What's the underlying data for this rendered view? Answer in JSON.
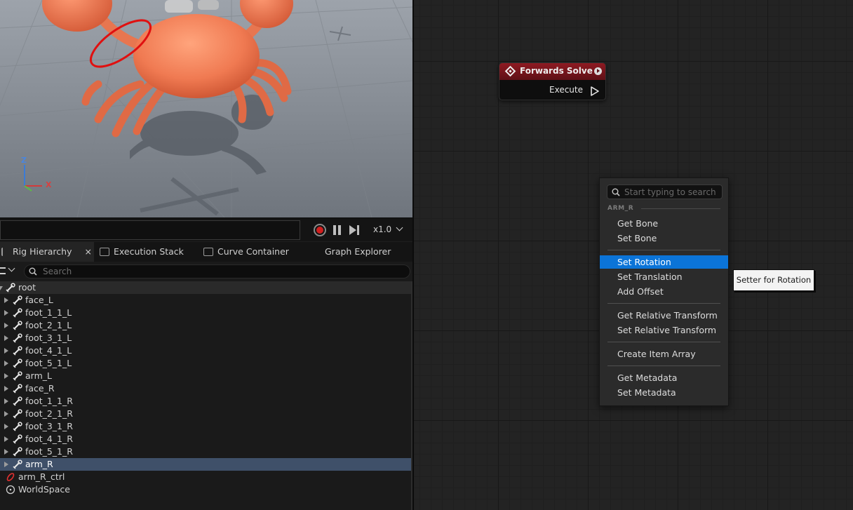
{
  "viewport": {
    "axes": {
      "z": "Z",
      "x": "X"
    }
  },
  "timeline": {
    "speed": "x1.0"
  },
  "tabs": [
    {
      "label": "Rig Hierarchy",
      "close": "×"
    },
    {
      "label": "Execution Stack"
    },
    {
      "label": "Curve Container"
    },
    {
      "label": "Graph Explorer"
    }
  ],
  "tree": {
    "search_placeholder": "Search",
    "items": [
      {
        "label": "root",
        "type": "bone"
      },
      {
        "label": "face_L",
        "type": "bone"
      },
      {
        "label": "foot_1_1_L",
        "type": "bone"
      },
      {
        "label": "foot_2_1_L",
        "type": "bone"
      },
      {
        "label": "foot_3_1_L",
        "type": "bone"
      },
      {
        "label": "foot_4_1_L",
        "type": "bone"
      },
      {
        "label": "foot_5_1_L",
        "type": "bone"
      },
      {
        "label": "arm_L",
        "type": "bone"
      },
      {
        "label": "face_R",
        "type": "bone"
      },
      {
        "label": "foot_1_1_R",
        "type": "bone"
      },
      {
        "label": "foot_2_1_R",
        "type": "bone"
      },
      {
        "label": "foot_3_1_R",
        "type": "bone"
      },
      {
        "label": "foot_4_1_R",
        "type": "bone"
      },
      {
        "label": "foot_5_1_R",
        "type": "bone"
      },
      {
        "label": "arm_R",
        "type": "bone"
      },
      {
        "label": "arm_R_ctrl",
        "type": "control"
      },
      {
        "label": "WorldSpace",
        "type": "null"
      }
    ]
  },
  "node": {
    "title": "Forwards Solve",
    "execute_label": "Execute"
  },
  "context_menu": {
    "search_placeholder": "Start typing to search",
    "section": "ARM_R",
    "items": [
      "Get Bone",
      "Set Bone",
      "Set Rotation",
      "Set Translation",
      "Add Offset",
      "Get Relative Transform",
      "Set Relative Transform",
      "Create Item Array",
      "Get Metadata",
      "Set Metadata"
    ],
    "highlighted": "Set Rotation"
  },
  "tooltip": "Setter for Rotation",
  "colors": {
    "node_header": "#8e1a22",
    "menu_highlight": "#0b74d8",
    "selected_row": "#3f5069",
    "record": "#d11e1e"
  }
}
